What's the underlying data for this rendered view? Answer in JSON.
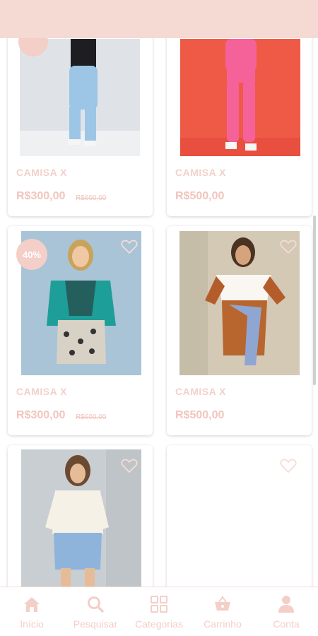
{
  "discount_badge": "40%",
  "products": [
    {
      "name": "CAMISA X",
      "price": "R$300,00",
      "old_price": "R$600,00"
    },
    {
      "name": "CAMISA X",
      "price": "R$500,00"
    },
    {
      "name": "CAMISA X",
      "price": "R$300,00",
      "old_price": "R$600,00"
    },
    {
      "name": "CAMISA X",
      "price": "R$500,00"
    }
  ],
  "bottom_nav": [
    {
      "label": "Início",
      "icon": "home-icon"
    },
    {
      "label": "Pesquisar",
      "icon": "search-icon"
    },
    {
      "label": "Categorias",
      "icon": "grid-icon"
    },
    {
      "label": "Carrinho",
      "icon": "basket-icon"
    },
    {
      "label": "Conta",
      "icon": "user-icon"
    }
  ],
  "colors": {
    "accent": "#f3cfc8",
    "topbar": "#f5d9d3",
    "text": "#f1c5bd"
  }
}
